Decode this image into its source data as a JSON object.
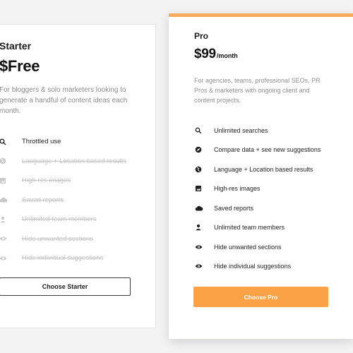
{
  "colors": {
    "accent": "#fba246",
    "pro_top_border": "#fbab5a",
    "disabled_text": "#c4c4c7",
    "muted_text": "#8f8f93"
  },
  "starter": {
    "name": "Starter",
    "price": "$Free",
    "description": "For bloggers & solo marketers looking to generate a handful of content ideas each month.",
    "features": [
      {
        "label": "Throttled use",
        "icon": "search-icon",
        "enabled": true
      },
      {
        "label": "Language + Location based results",
        "icon": "globe-icon",
        "enabled": false
      },
      {
        "label": "High-res images",
        "icon": "image-icon",
        "enabled": false
      },
      {
        "label": "Saved reports",
        "icon": "cloud-icon",
        "enabled": false
      },
      {
        "label": "Unlimited team members",
        "icon": "user-icon",
        "enabled": false
      },
      {
        "label": "Hide unwanted sections",
        "icon": "eye-icon",
        "enabled": false
      },
      {
        "label": "Hide individual suggestions",
        "icon": "eye-icon",
        "enabled": false
      }
    ],
    "button_label": "Choose Starter"
  },
  "pro": {
    "name": "Pro",
    "price": "$99",
    "period": "/month",
    "description": "For agencies, teams, professional SEOs, PR Pros & marketers with ongoing client and content projects.",
    "features": [
      {
        "label": "Unlimited searches",
        "icon": "search-icon"
      },
      {
        "label": "Compare data + see new suggestions",
        "icon": "compass-icon"
      },
      {
        "label": "Language + Location based results",
        "icon": "globe-icon"
      },
      {
        "label": "High-res images",
        "icon": "image-icon"
      },
      {
        "label": "Saved reports",
        "icon": "cloud-icon"
      },
      {
        "label": "Unlimited team members",
        "icon": "user-icon"
      },
      {
        "label": "Hide unwanted sections",
        "icon": "eye-icon"
      },
      {
        "label": "Hide individual suggestions",
        "icon": "eye-icon"
      }
    ],
    "button_label": "Choose Pro"
  }
}
